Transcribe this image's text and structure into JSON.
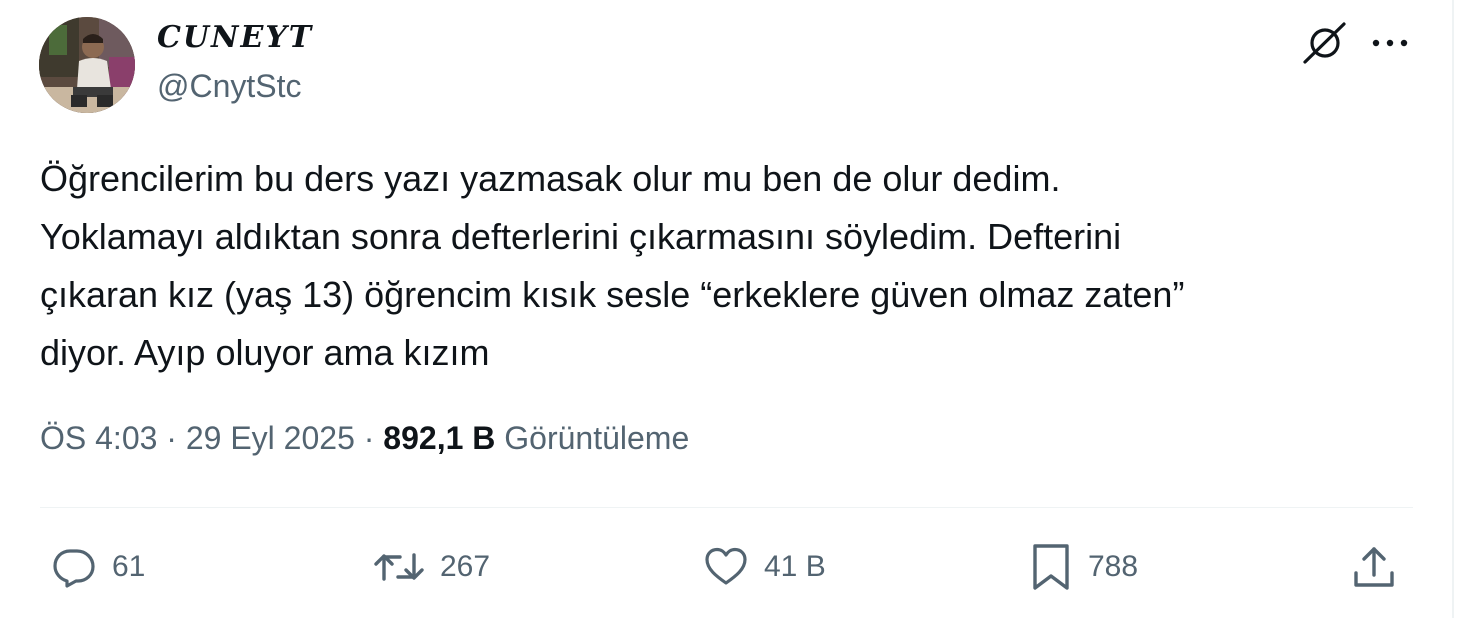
{
  "author": {
    "display_name": "CUNEYT",
    "handle": "@CnytStc"
  },
  "header_icons": [
    "grok-icon",
    "more-icon"
  ],
  "tweet": {
    "lines": [
      "Öğrencilerim bu ders yazı yazmasak olur mu ben de olur dedim.",
      "Yoklamayı aldıktan sonra defterlerini çıkarmasını söyledim. Defterini",
      "çıkaran kız (yaş 13) öğrencim kısık sesle “erkeklere güven olmaz zaten”",
      "diyor. Ayıp oluyor ama kızım"
    ]
  },
  "meta": {
    "time": "ÖS 4:03",
    "separator": "·",
    "date": "29 Eyl 2025",
    "views_count": "892,1 B",
    "views_label": "Görüntüleme"
  },
  "actions": {
    "reply": {
      "icon": "reply-icon",
      "count": "61"
    },
    "retweet": {
      "icon": "retweet-icon",
      "count": "267"
    },
    "like": {
      "icon": "heart-icon",
      "count": "41 B"
    },
    "bookmark": {
      "icon": "bookmark-icon",
      "count": "788"
    },
    "share": {
      "icon": "share-icon"
    }
  },
  "colors": {
    "text_primary": "#0f1419",
    "text_secondary": "#536471",
    "divider": "#eff3f4"
  }
}
